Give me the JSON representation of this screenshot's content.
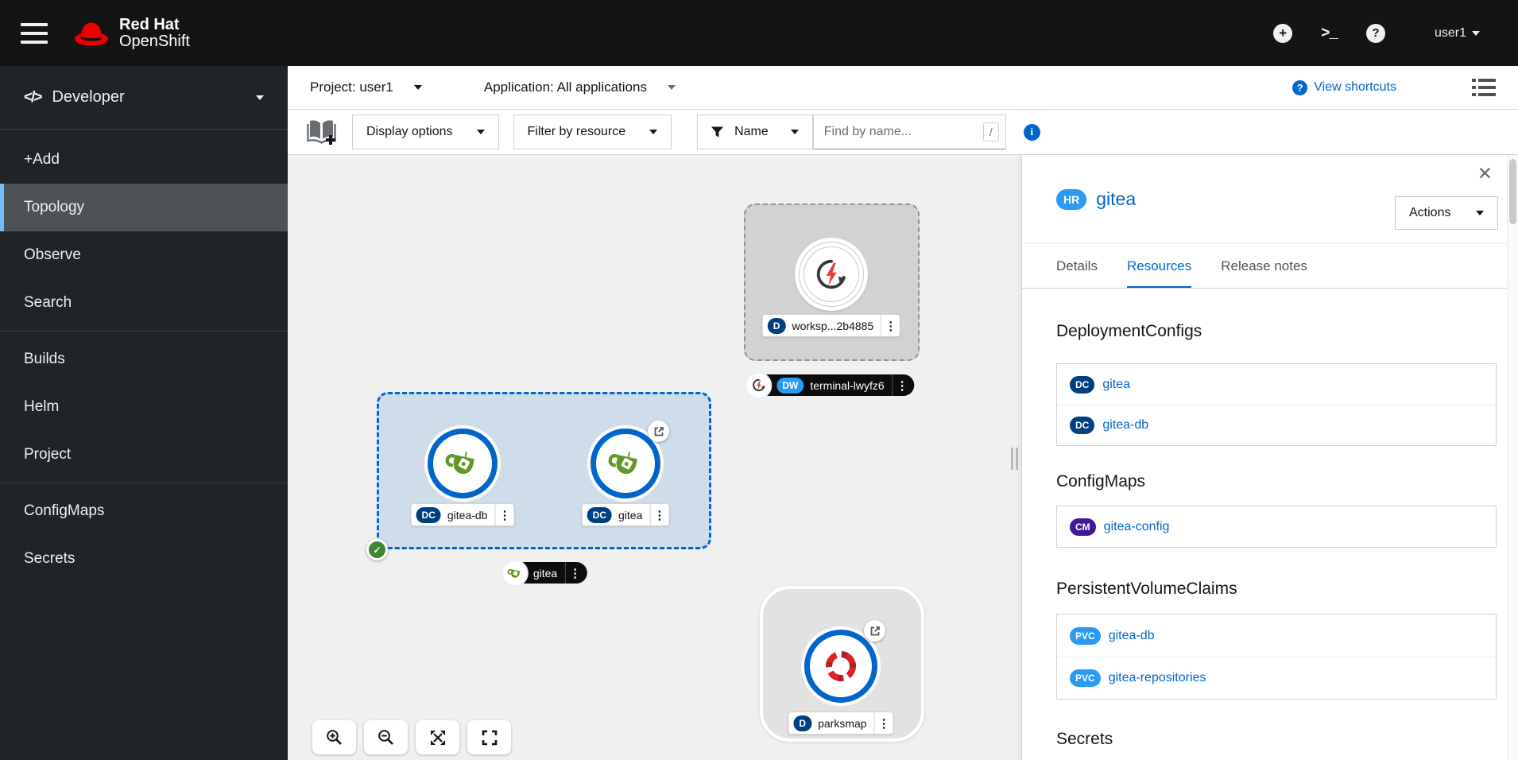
{
  "masthead": {
    "product_line1": "Red Hat",
    "product_line2": "OpenShift",
    "plus_icon": "plus-circle-icon",
    "terminal_icon": "terminal-icon",
    "help_icon": "help-circle-icon",
    "user_label": "user1"
  },
  "sidebar": {
    "perspective_icon": "code-icon",
    "perspective_label": "Developer",
    "groups": [
      {
        "items": [
          "+Add",
          "Topology",
          "Observe",
          "Search"
        ]
      },
      {
        "items": [
          "Builds",
          "Helm",
          "Project"
        ]
      },
      {
        "items": [
          "ConfigMaps",
          "Secrets"
        ]
      }
    ],
    "selected_item": "Topology"
  },
  "context_bar": {
    "project_label": "Project: user1",
    "application_label": "Application: All applications",
    "view_shortcuts_label": "View shortcuts"
  },
  "filter_bar": {
    "display_options_label": "Display options",
    "filter_by_resource_label": "Filter by resource",
    "name_filter_label": "Name",
    "find_placeholder": "Find by name...",
    "shortcut_key": "/"
  },
  "topology": {
    "workspace": {
      "badge": "D",
      "label": "worksp...2b4885"
    },
    "terminal": {
      "badge": "DW",
      "label": "terminal-lwyfz6"
    },
    "group": {
      "app_label": "gitea",
      "nodes": [
        {
          "badge": "DC",
          "label": "gitea-db"
        },
        {
          "badge": "DC",
          "label": "gitea"
        }
      ]
    },
    "parksmap": {
      "badge": "D",
      "label": "parksmap"
    }
  },
  "side_panel": {
    "resource_badge": "HR",
    "title": "gitea",
    "actions_label": "Actions",
    "tabs": [
      "Details",
      "Resources",
      "Release notes"
    ],
    "active_tab": "Resources",
    "sections": [
      {
        "heading": "DeploymentConfigs",
        "items": [
          {
            "badge": "DC",
            "name": "gitea"
          },
          {
            "badge": "DC",
            "name": "gitea-db"
          }
        ]
      },
      {
        "heading": "ConfigMaps",
        "items": [
          {
            "badge": "CM",
            "name": "gitea-config"
          }
        ]
      },
      {
        "heading": "PersistentVolumeClaims",
        "items": [
          {
            "badge": "PVC",
            "name": "gitea-db"
          },
          {
            "badge": "PVC",
            "name": "gitea-repositories"
          }
        ]
      },
      {
        "heading": "Secrets",
        "items": []
      }
    ]
  },
  "colors": {
    "accent_blue": "#0066cc",
    "badge_navy": "#004080",
    "badge_light_blue": "#2b9af3",
    "badge_purple": "#40199a",
    "selected_nav": "#73bcf7",
    "gitea_green": "#609926",
    "openshift_red": "#db2227",
    "success_green": "#3e8635"
  }
}
